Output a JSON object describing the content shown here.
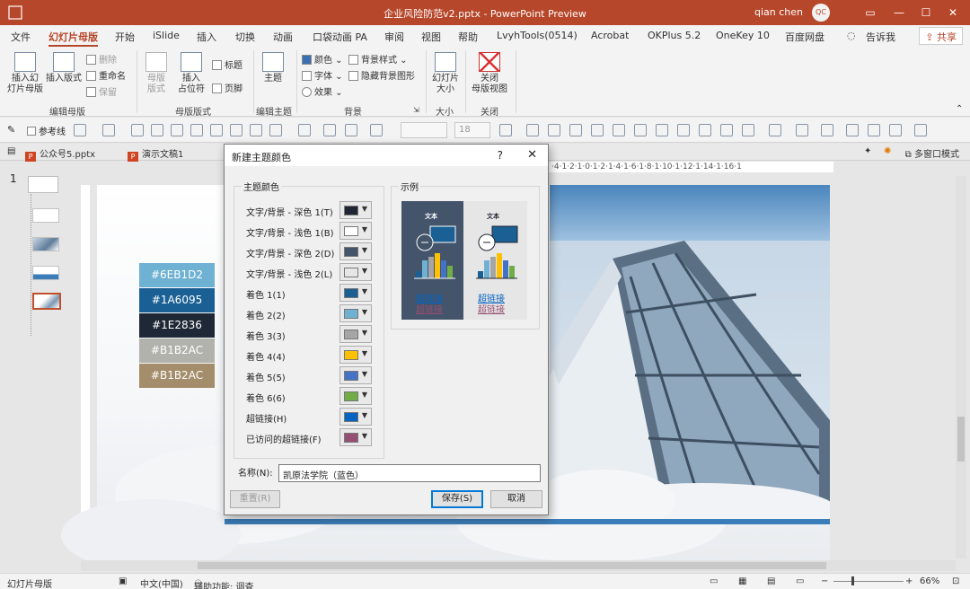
{
  "window": {
    "title": "企业风险防范v2.pptx  -  PowerPoint Preview",
    "user": "qian chen",
    "avatar": "QC",
    "minimize": "—",
    "restore": "☐",
    "close": "✕"
  },
  "menu": {
    "tabs": [
      "文件",
      "幻灯片母版",
      "开始",
      "iSlide",
      "插入",
      "切换",
      "动画",
      "口袋动画 PA",
      "审阅",
      "视图",
      "帮助",
      "LvyhTools(0514)",
      "Acrobat",
      "OKPlus 5.2",
      "OneKey 10",
      "百度网盘",
      "告诉我"
    ],
    "share": "共享"
  },
  "ribbon": {
    "insert_master": "插入幻\n灯片母版",
    "insert_layout": "插入版式",
    "delete": "删除",
    "rename": "重命名",
    "preserve": "保留",
    "master_layout": "母版\n版式",
    "insert_placeholder": "插入\n占位符",
    "title_chk": "标题",
    "footer_chk": "页脚",
    "theme": "主题",
    "colors": "颜色",
    "fonts": "字体",
    "effects": "效果",
    "bg_styles": "背景样式",
    "hide_bg": "隐藏背景图形",
    "slide_size": "幻灯片\n大小",
    "close_master": "关闭\n母版视图",
    "group_edit_master": "编辑母版",
    "group_master_layout": "母版版式",
    "group_edit_theme": "编辑主题",
    "group_background": "背景",
    "group_size": "大小",
    "group_close": "关闭"
  },
  "format_bar": {
    "reference_line": "参考线",
    "font_size": "18"
  },
  "doc_tabs": {
    "tab1": "公众号5.pptx",
    "tab2": "演示文稿1",
    "multi_window": "多窗口模式"
  },
  "thumbnails": {
    "number": "1"
  },
  "ruler": {
    "labels": "·4·1·2·1·0·1·2·1·4·1·6·1·8·1·10·1·12·1·14·1·16·1"
  },
  "swatches": [
    {
      "label": "#6EB1D2",
      "color": "#6EB1D2"
    },
    {
      "label": "#1A6095",
      "color": "#1A6095"
    },
    {
      "label": "#1E2836",
      "color": "#1E2836"
    },
    {
      "label": "#B1B2AC",
      "color": "#B1B2AC"
    },
    {
      "label": "#B1B2AC",
      "color": "#A48D6A"
    }
  ],
  "dialog": {
    "title": "新建主题颜色",
    "help": "?",
    "close": "✕",
    "group_label": "主题颜色",
    "preview_label": "示例",
    "rows": [
      {
        "label": "文字/背景 - 深色 1(T)",
        "color": "#1f2532"
      },
      {
        "label": "文字/背景 - 浅色 1(B)",
        "color": "#ffffff"
      },
      {
        "label": "文字/背景 - 深色 2(D)",
        "color": "#44546a"
      },
      {
        "label": "文字/背景 - 浅色 2(L)",
        "color": "#e7e6e6"
      },
      {
        "label": "着色 1(1)",
        "color": "#1a6095"
      },
      {
        "label": "着色 2(2)",
        "color": "#6eb1d2"
      },
      {
        "label": "着色 3(3)",
        "color": "#a5a5a5"
      },
      {
        "label": "着色 4(4)",
        "color": "#ffc000"
      },
      {
        "label": "着色 5(5)",
        "color": "#4472c4"
      },
      {
        "label": "着色 6(6)",
        "color": "#70ad47"
      },
      {
        "label": "超链接(H)",
        "color": "#0563c1"
      },
      {
        "label": "已访问的超链接(F)",
        "color": "#954f72"
      }
    ],
    "preview": {
      "text": "文本",
      "hyperlink": "超链接",
      "visited": "超链接"
    },
    "name_label": "名称(N):",
    "name_value": "凯原法学院（蓝色）",
    "reset": "重置(R)",
    "save": "保存(S)",
    "cancel": "取消"
  },
  "status": {
    "mode": "幻灯片母版",
    "language": "中文(中国)",
    "accessibility": "辅助功能: 调查",
    "zoom": "66%"
  }
}
